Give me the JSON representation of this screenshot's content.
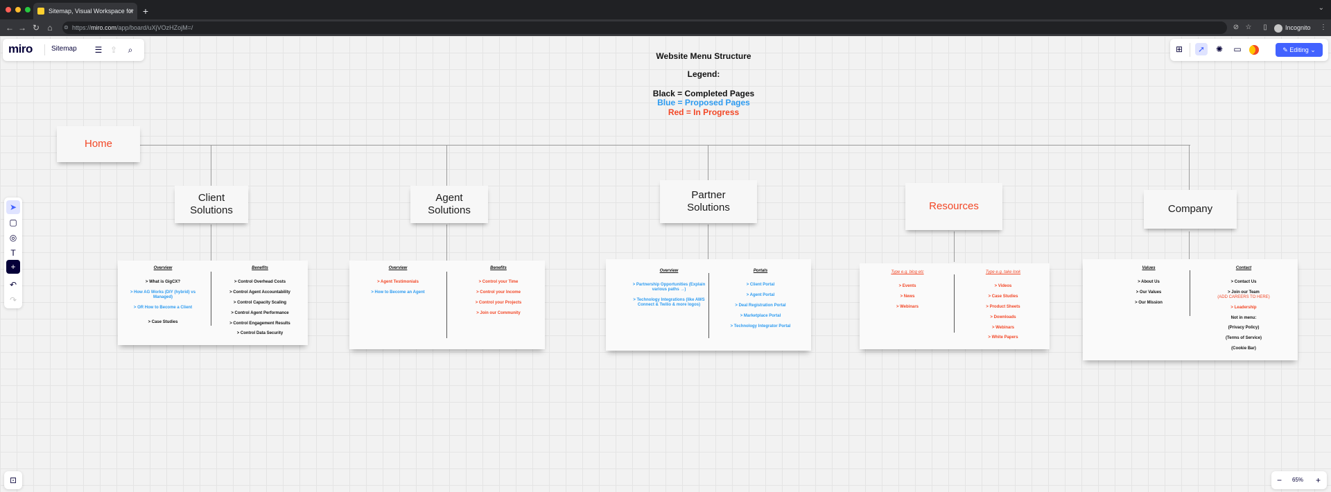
{
  "browser": {
    "tab_title": "Sitemap, Visual Workspace for",
    "tab_close": "×",
    "new_tab": "+",
    "url_host": "miro.com",
    "url_prefix": "https://",
    "url_path": "/app/board/uXjVOzHZojM=/",
    "profile": "Incognito"
  },
  "miro": {
    "logo": "miro",
    "board_name": "Sitemap",
    "editing_label": "Editing",
    "zoom_minus": "−",
    "zoom_level": "65%",
    "zoom_plus": "+"
  },
  "legend": {
    "title": "Website Menu Structure",
    "legend_label": "Legend:",
    "black": "Black = Completed Pages",
    "blue": "Blue = Proposed Pages",
    "red": "Red = In Progress"
  },
  "nodes": {
    "home": "Home",
    "client_1": "Client",
    "client_2": "Solutions",
    "agent_1": "Agent",
    "agent_2": "Solutions",
    "partner_1": "Partner",
    "partner_2": "Solutions",
    "resources": "Resources",
    "company": "Company"
  },
  "client_doc": {
    "left_header": "Overview",
    "left_items": [
      "> What is GigCX?",
      "> How AG Works (DIY (hybrid) vs Managed)",
      "> OR How to Become a Client",
      "> Case Studies"
    ],
    "right_header": "Benefits",
    "right_items": [
      "> Control Overhead Costs",
      "> Control Agent Accountability",
      "> Control Capacity Scaling",
      "> Control Agent Performance",
      "> Control Engagement Results",
      "> Control Data Security"
    ]
  },
  "agent_doc": {
    "left_header": "Overview",
    "left_items": [
      "> Agent Testimonials",
      "> How to Become an Agent"
    ],
    "right_header": "Benefits",
    "right_items": [
      "> Control your Time",
      "> Control your Income",
      "> Control your Projects",
      "> Join our Community"
    ]
  },
  "partner_doc": {
    "left_header": "Overview",
    "left_items": [
      "> Partnership Opportunities (Explain various paths →)",
      "> Technology Integrations (like AWS Connect & Twilio & more logos)"
    ],
    "right_header": "Portals",
    "right_items": [
      "> Client Portal",
      "> Agent Portal",
      "> Deal Registration Portal",
      "> Marketplace Portal",
      "> Technology Integrator Portal"
    ]
  },
  "resources_doc": {
    "left_header": "Type e.g. blog etc",
    "left_items": [
      "> Events",
      "> News",
      "> Webinars"
    ],
    "right_header": "Type e.g. take look",
    "right_items": [
      "> Videos",
      "> Case Studies",
      "> Product Sheets",
      "> Downloads",
      "> Webinars",
      "> White Papers"
    ]
  },
  "company_doc": {
    "left_header": "Values",
    "left_items": [
      "> About Us",
      "> Our Values",
      "> Our Mission"
    ],
    "right_header": "Contact",
    "right_items": [
      "> Contact Us",
      "> Join our Team",
      "(ADD CAREERS TO HERE)",
      "> Leadership"
    ],
    "not_in_menu": "Not in menu:",
    "extras": [
      "(Privacy Policy)",
      "(Terms of Service)",
      "(Cookie Bar)"
    ]
  }
}
